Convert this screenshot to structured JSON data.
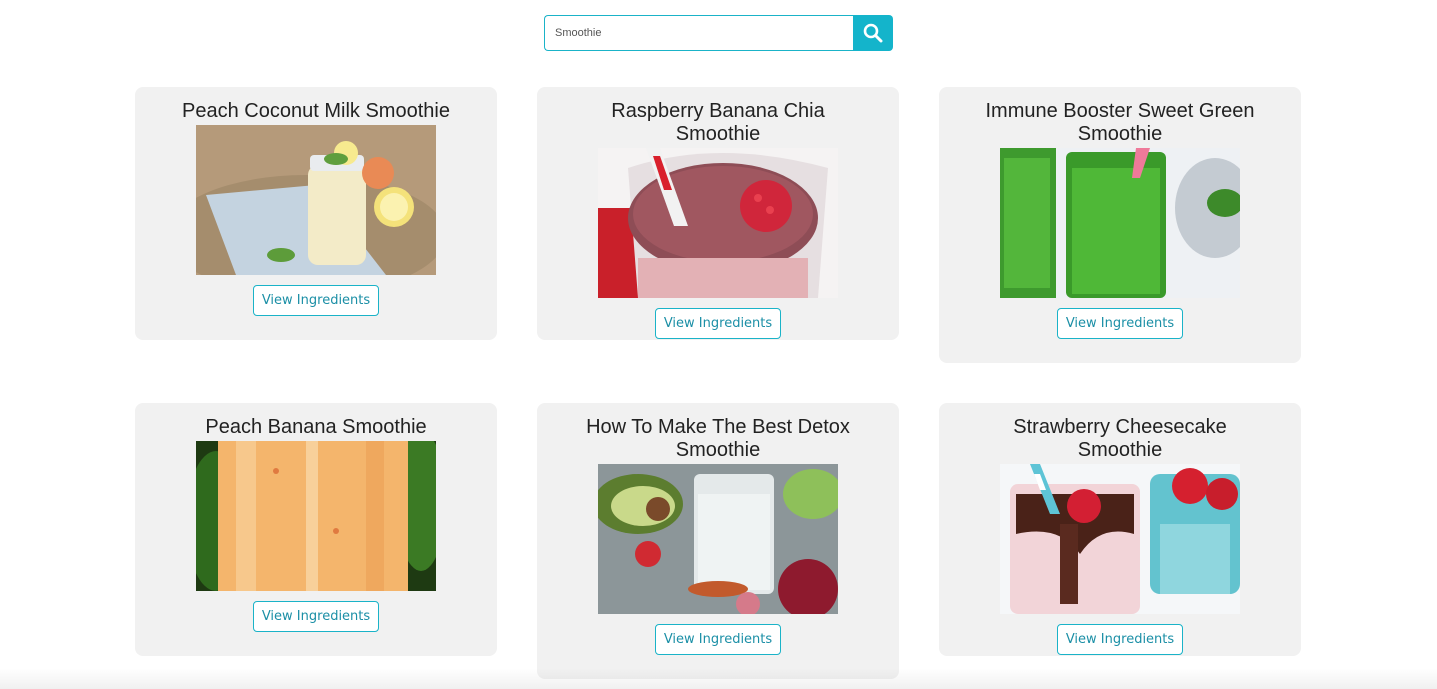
{
  "search": {
    "value": "Smoothie",
    "placeholder": "Search",
    "button_icon": "search-icon",
    "accent_color": "#14b4cb"
  },
  "cards": [
    {
      "title": "Peach Coconut Milk Smoothie",
      "button_label": "View Ingredients"
    },
    {
      "title": "Raspberry Banana Chia Smoothie",
      "button_label": "View Ingredients"
    },
    {
      "title": "Immune Booster Sweet Green Smoothie",
      "button_label": "View Ingredients"
    },
    {
      "title": "Peach Banana Smoothie",
      "button_label": "View Ingredients"
    },
    {
      "title": "How To Make The Best Detox Smoothie",
      "button_label": "View Ingredients"
    },
    {
      "title": "Strawberry Cheesecake Smoothie",
      "button_label": "View Ingredients"
    }
  ]
}
